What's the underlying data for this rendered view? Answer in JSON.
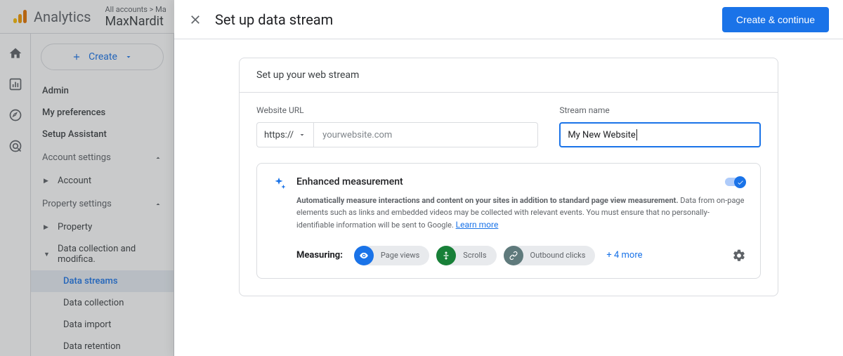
{
  "header": {
    "product": "Analytics",
    "breadcrumb_line1": "All accounts > Ma",
    "breadcrumb_line2": "MaxNardit"
  },
  "sidebar": {
    "create_label": "Create",
    "top_items": [
      "Admin",
      "My preferences",
      "Setup Assistant"
    ],
    "account_settings": {
      "header": "Account settings",
      "item": "Account"
    },
    "property_settings": {
      "header": "Property settings",
      "property": "Property",
      "data_collection": "Data collection and modifica.",
      "sub_items": [
        "Data streams",
        "Data collection",
        "Data import",
        "Data retention"
      ]
    }
  },
  "modal": {
    "title": "Set up data stream",
    "primary_button": "Create & continue",
    "card_header": "Set up your web stream",
    "url_label": "Website URL",
    "protocol": "https://",
    "url_placeholder": "yourwebsite.com",
    "stream_label": "Stream name",
    "stream_value": "My New Website",
    "enhanced": {
      "title": "Enhanced measurement",
      "desc_bold": "Automatically measure interactions and content on your sites in addition to standard page view measurement.",
      "desc_rest": " Data from on-page elements such as links and embedded videos may be collected with relevant events. You must ensure that no personally-identifiable information will be sent to Google. ",
      "learn_more": "Learn more"
    },
    "measuring": {
      "label": "Measuring:",
      "chips": [
        {
          "label": "Page views",
          "color": "chip-blue",
          "icon": "eye"
        },
        {
          "label": "Scrolls",
          "color": "chip-green",
          "icon": "scroll"
        },
        {
          "label": "Outbound clicks",
          "color": "chip-teal",
          "icon": "link"
        }
      ],
      "more": "+ 4 more"
    }
  }
}
